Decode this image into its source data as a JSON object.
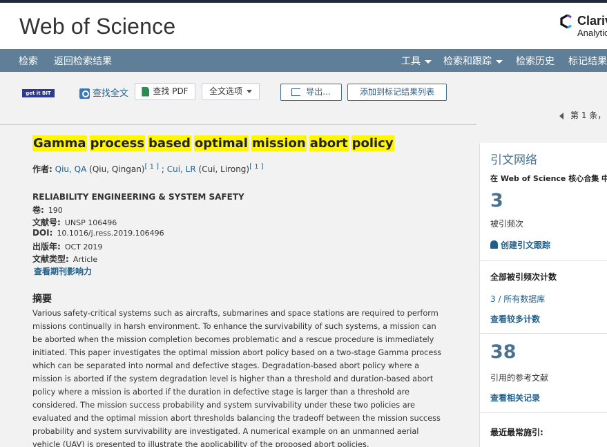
{
  "header": {
    "brand": "Web of Science",
    "clarivate_name": "Clariv",
    "clarivate_sub": "Analytic",
    "logo_icon": "clarivate-logo-icon"
  },
  "nav": {
    "left": [
      "检索",
      "返回检索结果"
    ],
    "right": [
      {
        "label": "工具",
        "dropdown": true
      },
      {
        "label": "检索和跟踪",
        "dropdown": true
      },
      {
        "label": "检索历史",
        "dropdown": false
      },
      {
        "label": "标记结果",
        "dropdown": false
      }
    ]
  },
  "toolbar": {
    "getit_label": "get it BIT",
    "find_fulltext": "查找全文",
    "find_pdf": "查找 PDF",
    "fulltext_options": "全文选项",
    "export": "导出...",
    "add_marked": "添加到标记结果列表",
    "pager": "第 1 条，"
  },
  "record": {
    "title_words": [
      "Gamma",
      "process",
      "based",
      "optimal",
      "mission",
      "abort",
      "policy"
    ],
    "authors_label": "作者:",
    "author1_link": "Qiu, QA",
    "author1_full": "(Qiu, Qingan)",
    "author1_ref": "[ 1 ]",
    "sep": ";",
    "author2_link": "Cui, LR",
    "author2_full": "(Cui, Lirong)",
    "author2_ref": "[ 1 ]",
    "journal": "RELIABILITY ENGINEERING & SYSTEM SAFETY",
    "meta": [
      {
        "key": "卷:",
        "value": "190"
      },
      {
        "key": "文献号:",
        "value": "UNSP 106496"
      },
      {
        "key": "DOI:",
        "value": "10.1016/j.ress.2019.106496"
      },
      {
        "key": "出版年:",
        "value": "OCT 2019"
      },
      {
        "key": "文献类型:",
        "value": "Article"
      }
    ],
    "impact_link": "查看期刊影响力",
    "abstract_heading": "摘要",
    "abstract": "Various safety-critical systems such as aircrafts, submarines and space stations are required to perform missions continually in harsh environment. To enhance the survivability of such systems, a mission can be aborted when the mission completion becomes problematic and a rescue procedure is immediately initiated. This paper investigates the optimal mission abort policy based on a two-stage Gamma process which can be separated into normal and defective stages. Degradation-based abort policy where a mission is aborted if the system degradation level is higher than a threshold and duration-based abort policy where a mission is aborted if the duration in defective stage is larger than a threshold are considered. The mission success probability and system survivability under these two policies are evaluated and the optimal mission abort thresholds balancing the tradeoff between the mission success probability and system survivability are investigated. A numerical example on an unmanned aerial vehicle (UAV) is presented to illustrate the applicability of the proposed abort policies."
  },
  "citation": {
    "heading": "引文网络",
    "sub": "在 Web of Science 核心合集 中",
    "times_cited": "3",
    "times_cited_label": "被引频次",
    "create_alert": "创建引文跟踪",
    "all_db_heading": "全部被引频次计数",
    "all_db_value": "3 / 所有数据库",
    "more_counts": "查看较多计数",
    "refs": "38",
    "refs_label": "引用的参考文献",
    "related": "查看相关记录",
    "most_recent": "最近最常施引:"
  },
  "colors": {
    "navbar": "#5f7f99",
    "highlight": "#fff600",
    "link": "#1f5f8a",
    "big_number": "#4a7190"
  }
}
